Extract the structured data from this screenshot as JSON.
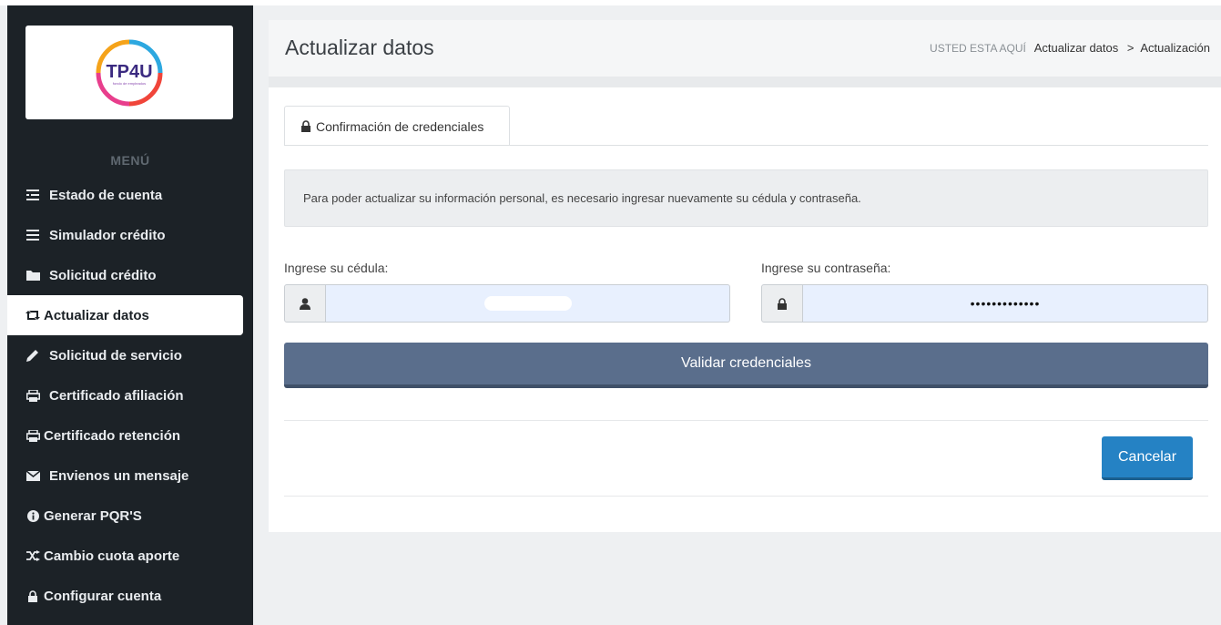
{
  "logo": {
    "text": "TP4U",
    "tagline": "fondo de empleados"
  },
  "sidebar": {
    "menu_title": "MENÚ",
    "items": [
      {
        "label": "Estado de cuenta",
        "icon": "list-icon"
      },
      {
        "label": "Simulador crédito",
        "icon": "bars-icon"
      },
      {
        "label": "Solicitud crédito",
        "icon": "folder-icon"
      },
      {
        "label": "Actualizar datos",
        "icon": "retweet-icon",
        "active": true
      },
      {
        "label": "Solicitud de servicio",
        "icon": "pencil-icon"
      },
      {
        "label": "Certificado afiliación",
        "icon": "print-icon"
      },
      {
        "label": "Certificado retención",
        "icon": "print-icon"
      },
      {
        "label": "Envienos un mensaje",
        "icon": "envelope-icon"
      },
      {
        "label": "Generar PQR'S",
        "icon": "info-icon"
      },
      {
        "label": "Cambio cuota aporte",
        "icon": "random-icon"
      },
      {
        "label": "Configurar cuenta",
        "icon": "lock-icon"
      }
    ]
  },
  "header": {
    "title": "Actualizar datos",
    "breadcrumb_label": "USTED ESTA AQUÍ",
    "breadcrumb_path": "Actualizar datos",
    "breadcrumb_sep": ">",
    "breadcrumb_current": "Actualización"
  },
  "tab": {
    "label": "Confirmación de credenciales"
  },
  "alert": {
    "text": "Para poder actualizar su información personal, es necesario ingresar nuevamente su cédula y contraseña."
  },
  "form": {
    "cedula_label": "Ingrese su cédula:",
    "cedula_value": "",
    "password_label": "Ingrese su contraseña:",
    "password_value": "•••••••••••••",
    "validate_label": "Validar credenciales",
    "cancel_label": "Cancelar"
  },
  "colors": {
    "sidebar_bg": "#1c2227",
    "validate_bg": "#5a6e8c",
    "cancel_bg": "#2582c4",
    "input_bg": "#e8f0fe"
  }
}
